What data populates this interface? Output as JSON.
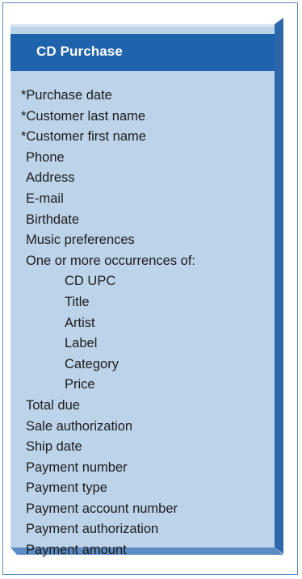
{
  "entity": {
    "title": "CD Purchase",
    "fields": [
      {
        "text": "*Purchase date",
        "level": "required"
      },
      {
        "text": "*Customer last name",
        "level": "required"
      },
      {
        "text": "*Customer first name",
        "level": "required"
      },
      {
        "text": "Phone",
        "level": "plain"
      },
      {
        "text": "Address",
        "level": "plain"
      },
      {
        "text": "E-mail",
        "level": "plain"
      },
      {
        "text": "Birthdate",
        "level": "plain"
      },
      {
        "text": "Music preferences",
        "level": "plain"
      },
      {
        "text": "One or more occurrences of:",
        "level": "plain"
      },
      {
        "text": "CD UPC",
        "level": "sub"
      },
      {
        "text": "Title",
        "level": "sub"
      },
      {
        "text": "Artist",
        "level": "sub"
      },
      {
        "text": "Label",
        "level": "sub"
      },
      {
        "text": "Category",
        "level": "sub"
      },
      {
        "text": "Price",
        "level": "sub"
      },
      {
        "text": "Total due",
        "level": "plain"
      },
      {
        "text": "Sale authorization",
        "level": "plain"
      },
      {
        "text": "Ship date",
        "level": "plain"
      },
      {
        "text": "Payment number",
        "level": "plain"
      },
      {
        "text": "Payment type",
        "level": "plain"
      },
      {
        "text": "Payment account number",
        "level": "plain"
      },
      {
        "text": "Payment authorization",
        "level": "plain"
      },
      {
        "text": "Payment amount",
        "level": "plain"
      }
    ]
  },
  "colors": {
    "frame_border": "#5b86c3",
    "card_fill": "#bcd3ea",
    "header_fill": "#1f63ad",
    "shadow": "#2e66aa",
    "text": "#1c1c1c",
    "header_text": "#ffffff"
  }
}
